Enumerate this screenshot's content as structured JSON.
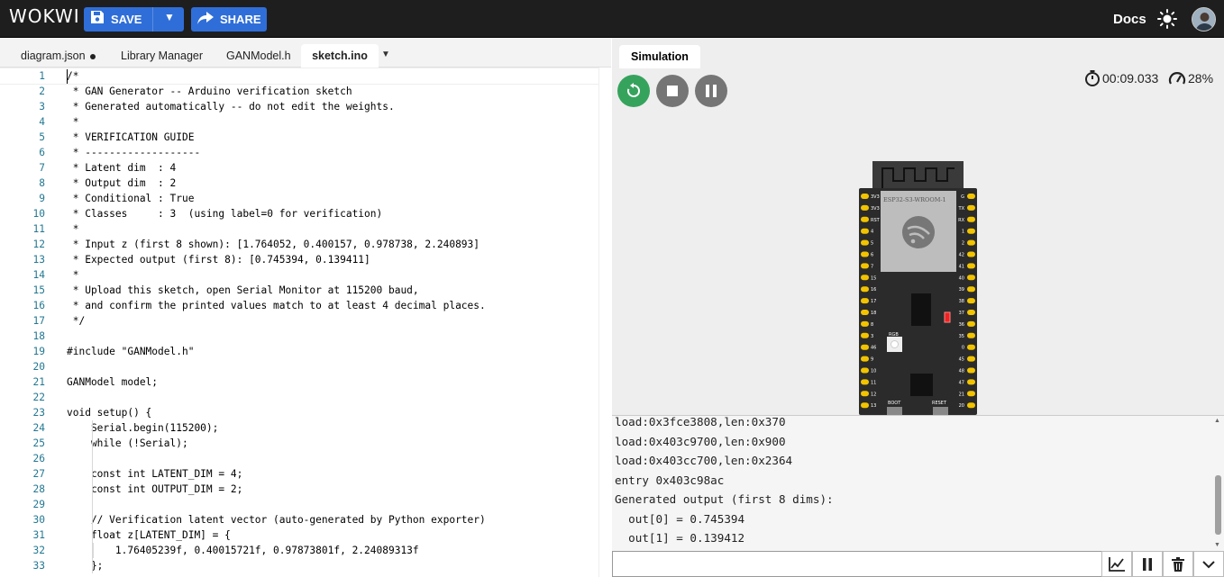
{
  "app": {
    "logo": "WOKWI",
    "save_label": "SAVE",
    "share_label": "SHARE",
    "docs_label": "Docs",
    "accent_color": "#2f6ed8"
  },
  "editor": {
    "tabs": [
      {
        "label": "diagram.json",
        "modified": true
      },
      {
        "label": "Library Manager"
      },
      {
        "label": "GANModel.h"
      },
      {
        "label": "sketch.ino",
        "active": true
      }
    ],
    "lines": [
      "/*",
      " * GAN Generator -- Arduino verification sketch",
      " * Generated automatically -- do not edit the weights.",
      " *",
      " * VERIFICATION GUIDE",
      " * -------------------",
      " * Latent dim  : 4",
      " * Output dim  : 2",
      " * Conditional : True",
      " * Classes     : 3  (using label=0 for verification)",
      " *",
      " * Input z (first 8 shown): [1.764052, 0.400157, 0.978738, 2.240893]",
      " * Expected output (first 8): [0.745394, 0.139411]",
      " *",
      " * Upload this sketch, open Serial Monitor at 115200 baud,",
      " * and confirm the printed values match to at least 4 decimal places.",
      " */",
      "",
      "#include \"GANModel.h\"",
      "",
      "GANModel model;",
      "",
      "void setup() {",
      "    Serial.begin(115200);",
      "    while (!Serial);",
      "",
      "    const int LATENT_DIM = 4;",
      "    const int OUTPUT_DIM = 2;",
      "",
      "    // Verification latent vector (auto-generated by Python exporter)",
      "    float z[LATENT_DIM] = {",
      "        1.76405239f, 0.40015721f, 0.97873801f, 2.24089313f",
      "    };"
    ]
  },
  "simulation": {
    "tab_label": "Simulation",
    "timer": "00:09.033",
    "speed": "28%",
    "board_label": "ESP32-S3-WROOM-1",
    "rgb_label": "RGB",
    "boot_label": "BOOT",
    "reset_label": "RESET",
    "left_pins": [
      "3V3",
      "3V3",
      "RST",
      "4",
      "5",
      "6",
      "7",
      "15",
      "16",
      "17",
      "18",
      "8",
      "3",
      "46",
      "9",
      "10",
      "11",
      "12",
      "13"
    ],
    "right_pins": [
      "G",
      "TX",
      "RX",
      "1",
      "2",
      "42",
      "41",
      "40",
      "39",
      "38",
      "37",
      "36",
      "35",
      "0",
      "45",
      "48",
      "47",
      "21",
      "20"
    ]
  },
  "serial": {
    "lines": [
      "load:0x3fce3808,len:0x370",
      "load:0x403c9700,len:0x900",
      "load:0x403cc700,len:0x2364",
      "entry 0x403c98ac",
      "Generated output (first 8 dims):",
      "  out[0] = 0.745394",
      "  out[1] = 0.139412"
    ],
    "input_value": ""
  }
}
